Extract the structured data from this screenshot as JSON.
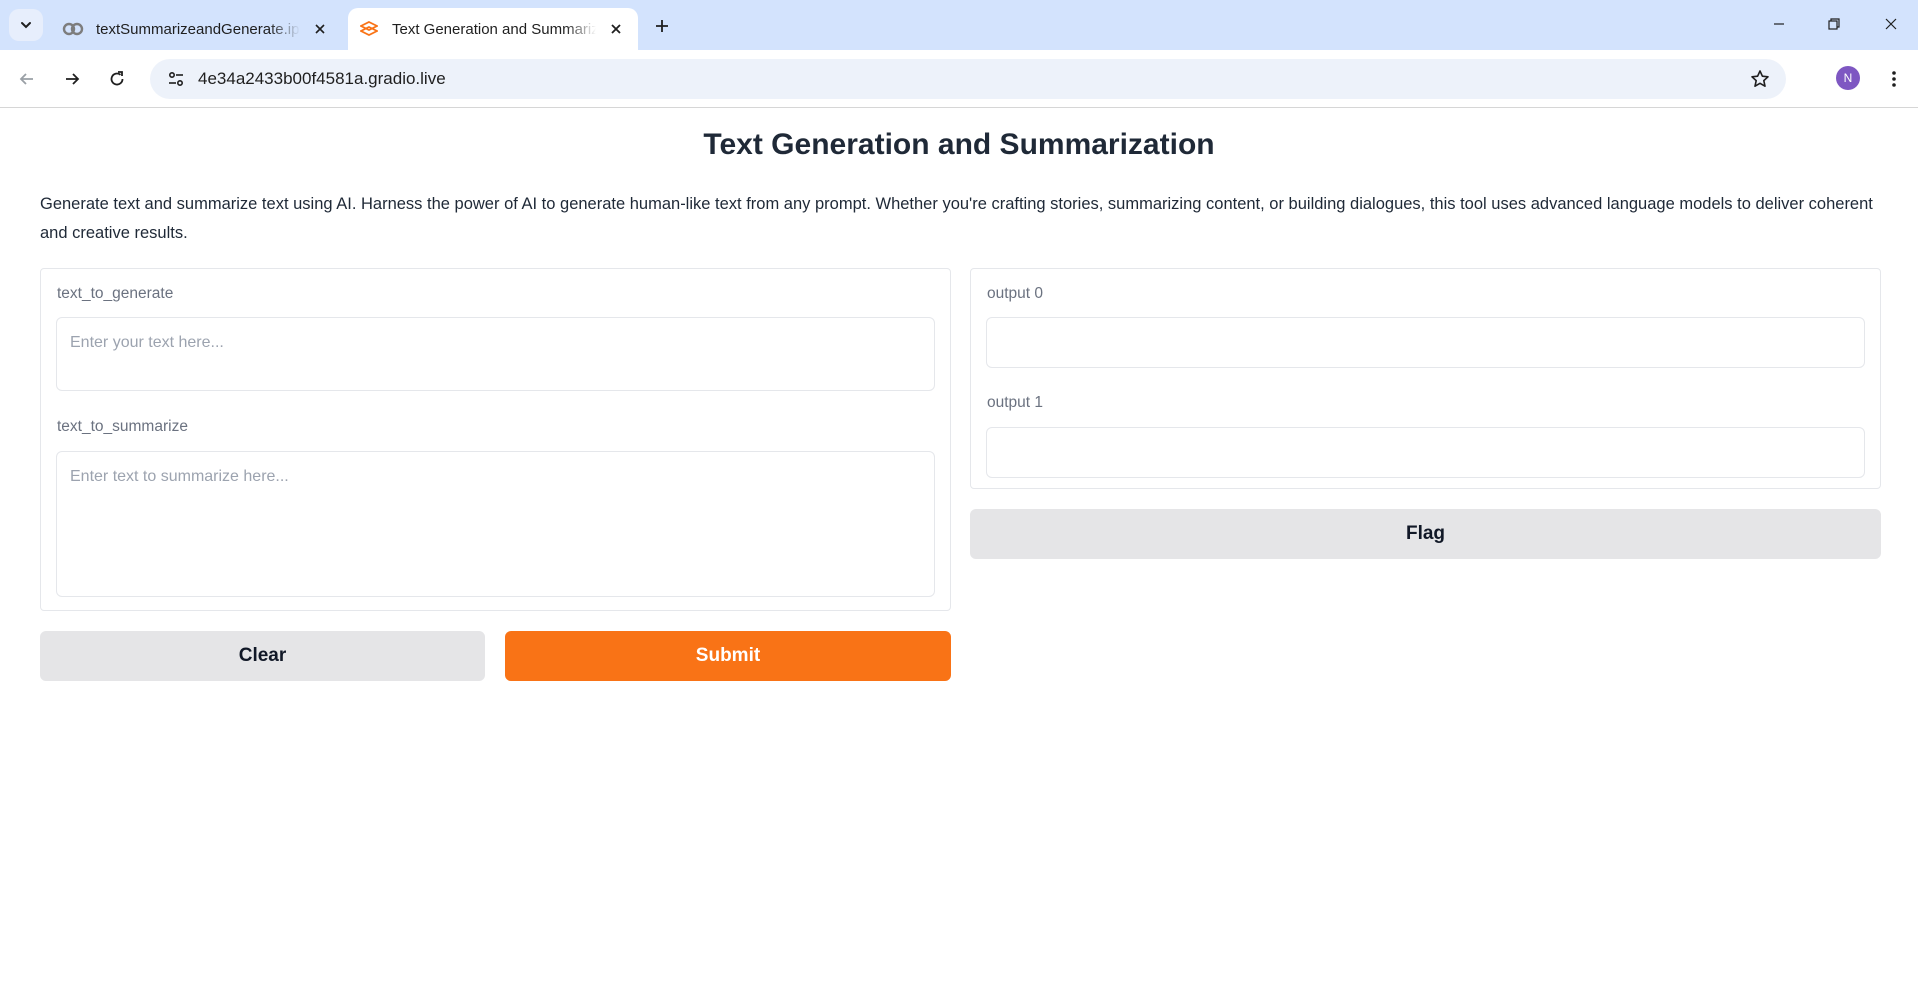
{
  "browser": {
    "tabs": [
      {
        "title": "textSummarizeandGenerate.ipynb",
        "active": false,
        "favicon": "colab-icon"
      },
      {
        "title": "Text Generation and Summarization",
        "active": true,
        "favicon": "gradio-icon"
      }
    ],
    "url": "4e34a2433b00f4581a.gradio.live",
    "profile_initial": "N",
    "accent_color": "#d3e3fd"
  },
  "page": {
    "title": "Text Generation and Summarization",
    "description": "Generate text and summarize text using AI. Harness the power of AI to generate human-like text from any prompt. Whether you're crafting stories, summarizing content, or building dialogues, this tool uses advanced language models to deliver coherent and creative results."
  },
  "inputs": {
    "generate": {
      "label": "text_to_generate",
      "placeholder": "Enter your text here...",
      "value": ""
    },
    "summarize": {
      "label": "text_to_summarize",
      "placeholder": "Enter text to summarize here...",
      "value": ""
    }
  },
  "outputs": {
    "output0": {
      "label": "output 0",
      "value": ""
    },
    "output1": {
      "label": "output 1",
      "value": ""
    }
  },
  "buttons": {
    "clear": "Clear",
    "submit": "Submit",
    "flag": "Flag",
    "primary_color": "#f97316"
  }
}
